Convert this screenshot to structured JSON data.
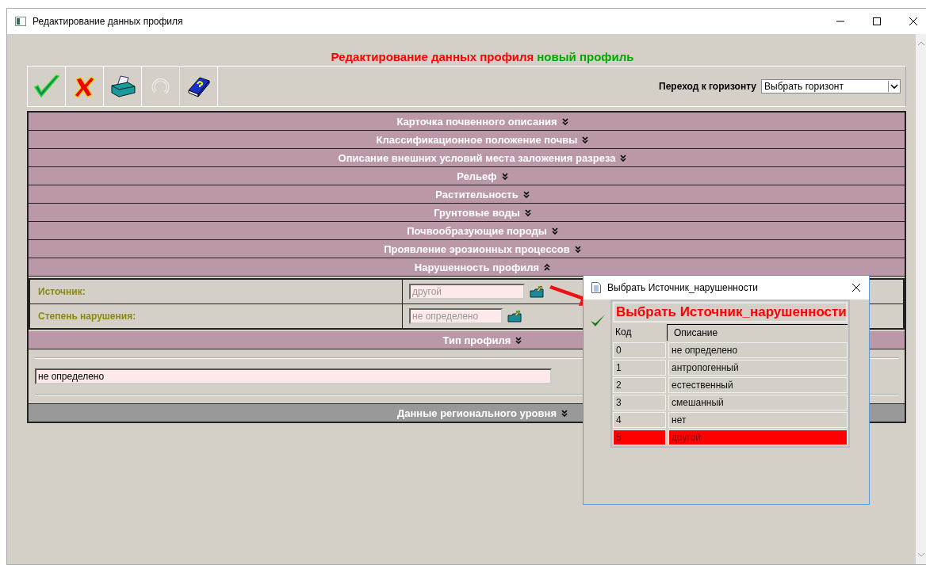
{
  "window": {
    "title": "Редактирование данных профиля"
  },
  "heading": {
    "title": "Редактирование данных профиля",
    "subtitle": "новый профиль"
  },
  "toolbar": {
    "buttons": [
      {
        "kind": "save",
        "disabled": false
      },
      {
        "kind": "cancel",
        "disabled": false
      },
      {
        "kind": "print",
        "disabled": false
      },
      {
        "kind": "undo",
        "disabled": true
      },
      {
        "kind": "help",
        "disabled": false
      }
    ],
    "horizon_label": "Переход к горизонту",
    "horizon_select": "Выбрать горизонт"
  },
  "sections": [
    {
      "title": "Карточка почвенного описания",
      "expanded": false,
      "kind": "group"
    },
    {
      "title": "Классификационное положение почвы",
      "expanded": false,
      "kind": "group"
    },
    {
      "title": "Описание внешних условий места заложения разреза",
      "expanded": false,
      "kind": "group"
    },
    {
      "title": "Рельеф",
      "expanded": false,
      "kind": "group"
    },
    {
      "title": "Растительность",
      "expanded": false,
      "kind": "group"
    },
    {
      "title": "Грунтовые воды",
      "expanded": false,
      "kind": "group"
    },
    {
      "title": "Почвообразующие породы",
      "expanded": false,
      "kind": "group"
    },
    {
      "title": "Проявление эрозионных процессов",
      "expanded": false,
      "kind": "group"
    },
    {
      "title": "Нарушенность профиля",
      "expanded": true,
      "kind": "group",
      "fields": [
        {
          "label": "Источник:",
          "value": "другой",
          "disabled": true
        },
        {
          "label": "Степень нарушения:",
          "value": "не определено",
          "disabled": true
        }
      ]
    },
    {
      "title": "Тип профиля",
      "expanded": false,
      "kind": "group",
      "value": "не определено"
    },
    {
      "title": "Данные регионального уровня",
      "expanded": false,
      "kind": "regional"
    }
  ],
  "dialog": {
    "title": "Выбрать Источник_нарушенности",
    "heading": "Выбрать Источник_нарушенности",
    "columns": [
      "Код",
      "Описание"
    ],
    "rows": [
      {
        "code": "0",
        "description": "не определено",
        "selected": false
      },
      {
        "code": "1",
        "description": "антропогенный",
        "selected": false
      },
      {
        "code": "2",
        "description": "естественный",
        "selected": false
      },
      {
        "code": "3",
        "description": "смешанный",
        "selected": false
      },
      {
        "code": "4",
        "description": "нет",
        "selected": false
      },
      {
        "code": "5",
        "description": "другой",
        "selected": true
      }
    ]
  }
}
